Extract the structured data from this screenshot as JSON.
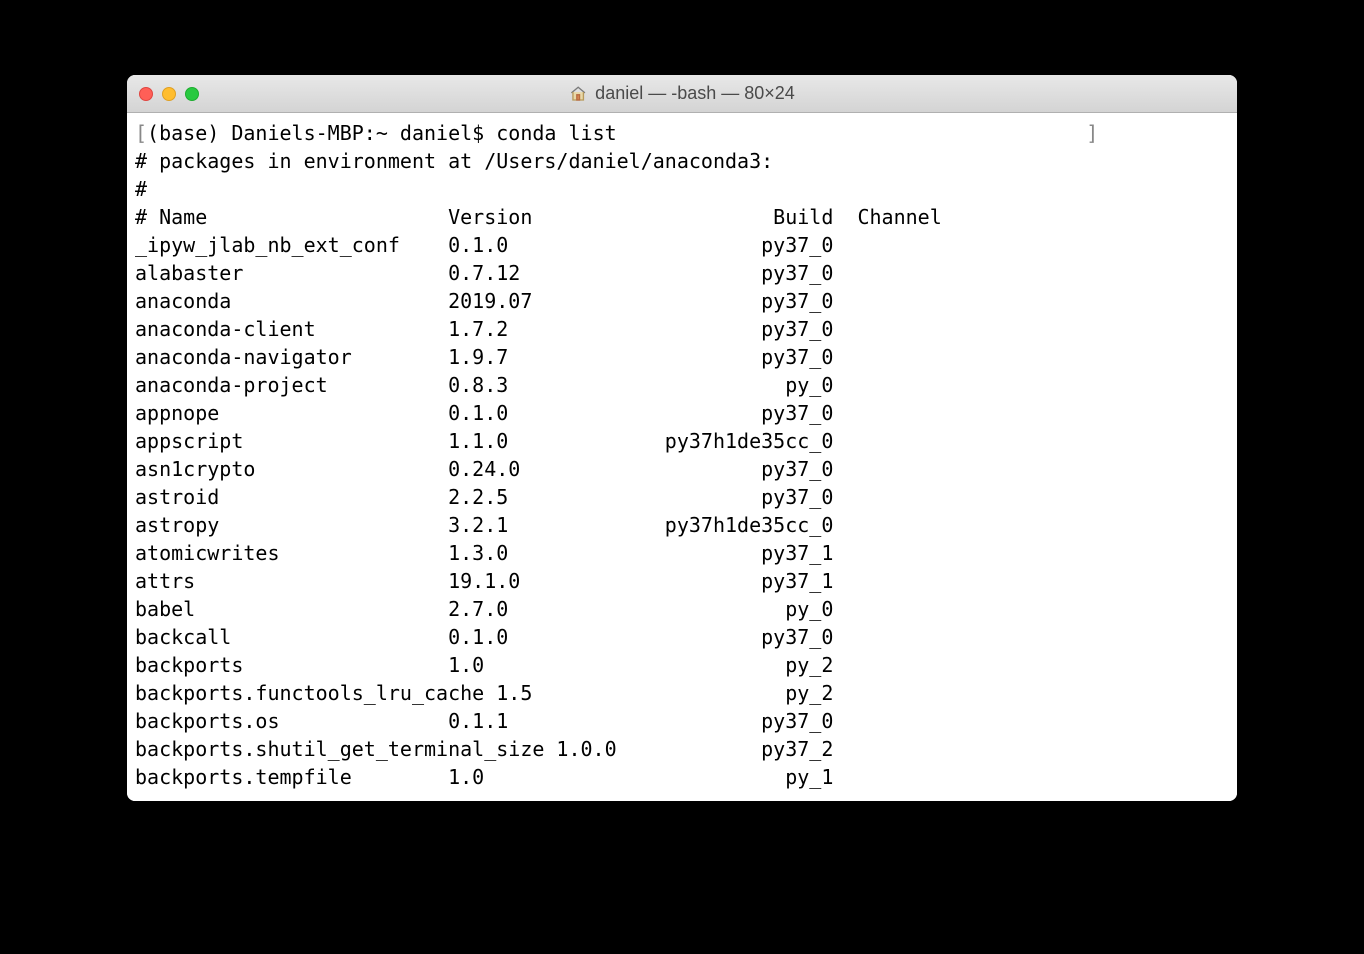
{
  "window": {
    "title": "daniel — -bash — 80×24"
  },
  "terminal": {
    "prompt_open": "[",
    "prompt_close": "]",
    "prompt": "(base) Daniels-MBP:~ daniel$ ",
    "command": "conda list",
    "env_line": "# packages in environment at /Users/daniel/anaconda3:",
    "hash_line": "#",
    "header": {
      "name": "# Name",
      "version": "Version",
      "build": "Build",
      "channel": "Channel"
    },
    "packages": [
      {
        "name": "_ipyw_jlab_nb_ext_conf",
        "version": "0.1.0",
        "build": "py37_0",
        "channel": ""
      },
      {
        "name": "alabaster",
        "version": "0.7.12",
        "build": "py37_0",
        "channel": ""
      },
      {
        "name": "anaconda",
        "version": "2019.07",
        "build": "py37_0",
        "channel": ""
      },
      {
        "name": "anaconda-client",
        "version": "1.7.2",
        "build": "py37_0",
        "channel": ""
      },
      {
        "name": "anaconda-navigator",
        "version": "1.9.7",
        "build": "py37_0",
        "channel": ""
      },
      {
        "name": "anaconda-project",
        "version": "0.8.3",
        "build": "py_0",
        "channel": ""
      },
      {
        "name": "appnope",
        "version": "0.1.0",
        "build": "py37_0",
        "channel": ""
      },
      {
        "name": "appscript",
        "version": "1.1.0",
        "build": "py37h1de35cc_0",
        "channel": ""
      },
      {
        "name": "asn1crypto",
        "version": "0.24.0",
        "build": "py37_0",
        "channel": ""
      },
      {
        "name": "astroid",
        "version": "2.2.5",
        "build": "py37_0",
        "channel": ""
      },
      {
        "name": "astropy",
        "version": "3.2.1",
        "build": "py37h1de35cc_0",
        "channel": ""
      },
      {
        "name": "atomicwrites",
        "version": "1.3.0",
        "build": "py37_1",
        "channel": ""
      },
      {
        "name": "attrs",
        "version": "19.1.0",
        "build": "py37_1",
        "channel": ""
      },
      {
        "name": "babel",
        "version": "2.7.0",
        "build": "py_0",
        "channel": ""
      },
      {
        "name": "backcall",
        "version": "0.1.0",
        "build": "py37_0",
        "channel": ""
      },
      {
        "name": "backports",
        "version": "1.0",
        "build": "py_2",
        "channel": ""
      },
      {
        "name": "backports.functools_lru_cache",
        "version": "1.5",
        "build": "py_2",
        "channel": ""
      },
      {
        "name": "backports.os",
        "version": "0.1.1",
        "build": "py37_0",
        "channel": ""
      },
      {
        "name": "backports.shutil_get_terminal_size",
        "version": "1.0.0",
        "build": "py37_2",
        "channel": ""
      },
      {
        "name": "backports.tempfile",
        "version": "1.0",
        "build": "py_1",
        "channel": ""
      }
    ]
  },
  "columns": {
    "name_width": 26,
    "version_width": 17,
    "build_width": 15
  }
}
